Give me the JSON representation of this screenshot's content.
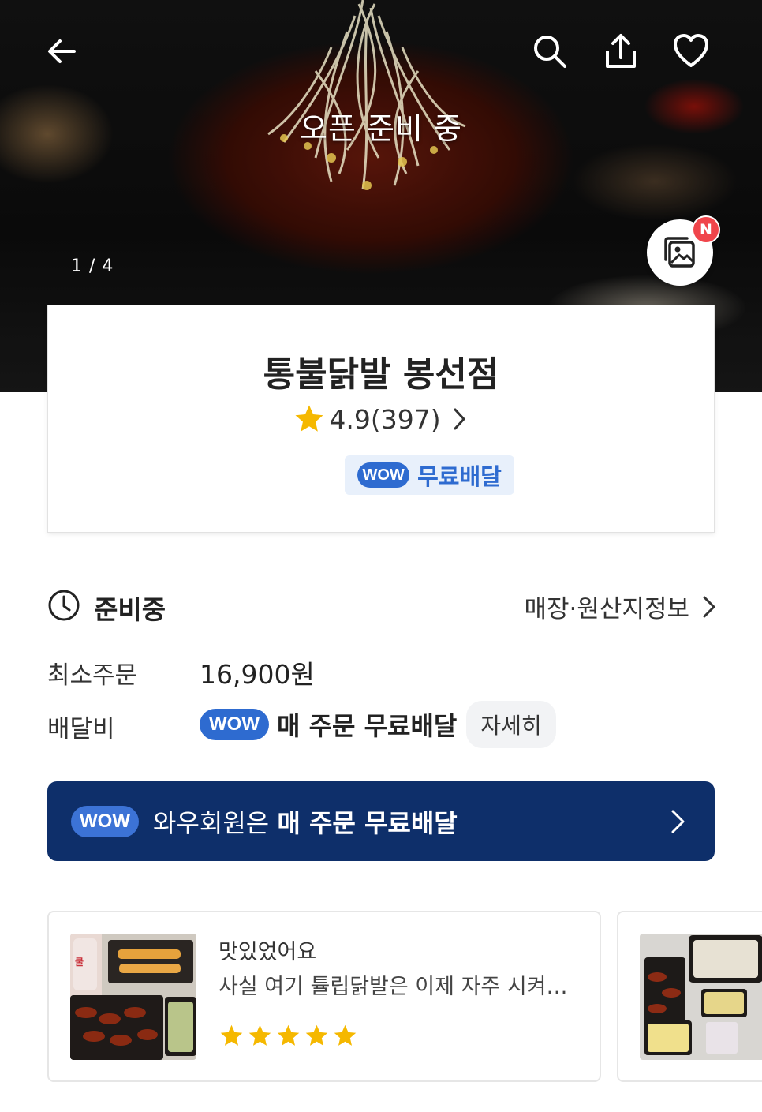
{
  "hero": {
    "status_text": "오픈 준비 중",
    "photo_counter": "1 / 4",
    "new_badge": "N"
  },
  "top_bar": {
    "icons": [
      "back-arrow-icon",
      "search-icon",
      "share-icon",
      "heart-icon"
    ]
  },
  "store": {
    "name": "통불닭발 봉선점",
    "rating": "4.9(397)",
    "wow_badge": "WOW",
    "free_delivery_label": "무료배달"
  },
  "status": {
    "label": "준비중",
    "store_info_link": "매장·원산지정보"
  },
  "info": {
    "min_order_label": "최소주문",
    "min_order_value": "16,900원",
    "delivery_fee_label": "배달비",
    "delivery_wow_badge": "WOW",
    "delivery_fee_value": "매 주문 무료배달",
    "detail_button": "자세히"
  },
  "banner": {
    "wow_badge": "WOW",
    "text_prefix": "와우회원은 ",
    "text_bold": "매 주문 무료배달"
  },
  "reviews": [
    {
      "title": "맛있었어요",
      "body": "사실 여기 튤립닭발은 이제 자주 시켜…",
      "stars": 5
    }
  ],
  "colors": {
    "accent_blue": "#2e6bd0",
    "banner_navy": "#0e2f6a",
    "star_yellow": "#f5b800",
    "new_badge_red": "#f0454b"
  }
}
